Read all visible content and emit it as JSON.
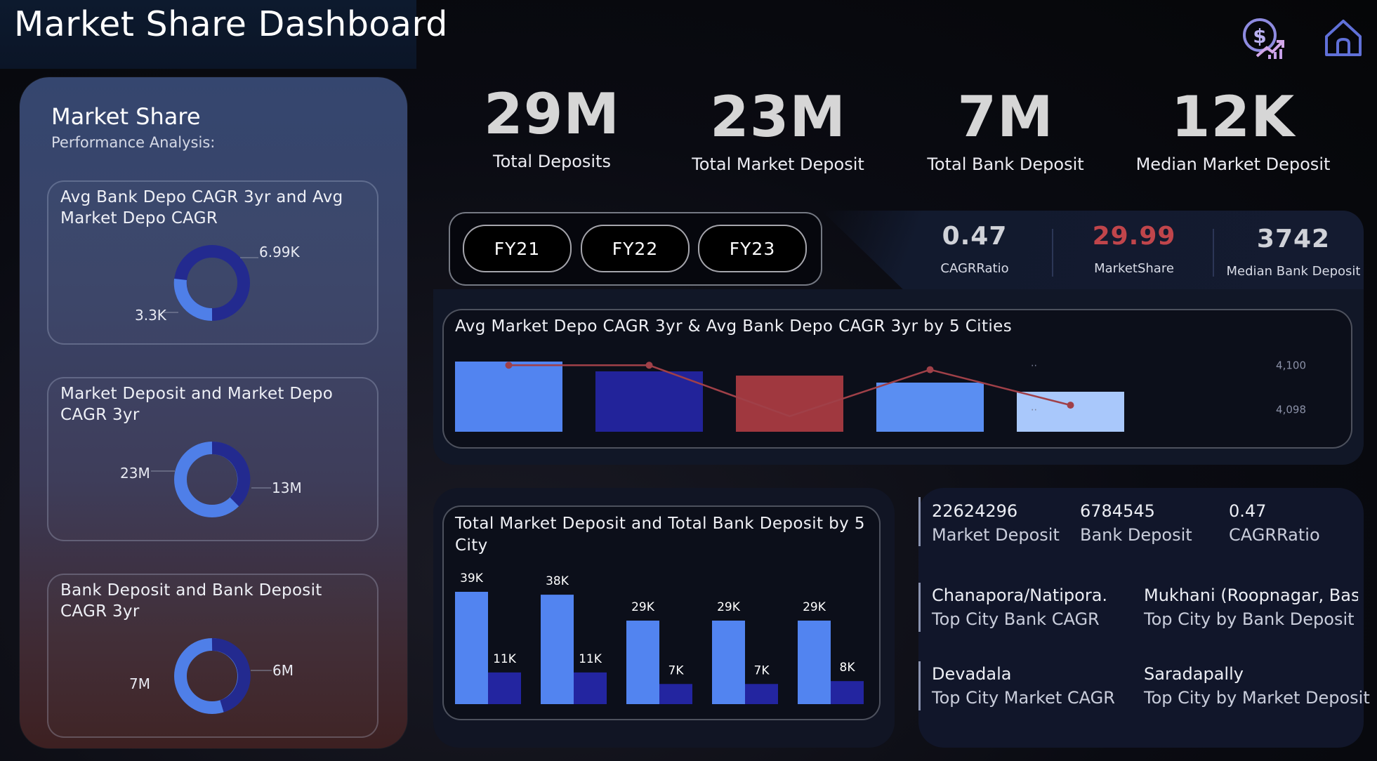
{
  "header": {
    "title": "Market Share Dashboard"
  },
  "left_panel": {
    "title": "Market Share",
    "subtitle": "Performance Analysis:",
    "cards": [
      {
        "title": "Avg Bank Depo CAGR 3yr and Avg Market Depo CAGR",
        "label_a": "6.99K",
        "label_b": "3.3K",
        "value_a": 6990,
        "value_b": 3300
      },
      {
        "title": "Market Deposit and Market Depo CAGR 3yr",
        "label_a": "13M",
        "label_b": "23M",
        "value_a": 13,
        "value_b": 23
      },
      {
        "title": "Bank Deposit and Bank Deposit CAGR 3yr",
        "label_a": "6M",
        "label_b": "7M",
        "value_a": 6,
        "value_b": 7
      }
    ]
  },
  "kpis": [
    {
      "value": "29M",
      "label": "Total Deposits"
    },
    {
      "value": "23M",
      "label": "Total Market Deposit"
    },
    {
      "value": "7M",
      "label": "Total Bank Deposit"
    },
    {
      "value": "12K",
      "label": "Median Market Deposit"
    }
  ],
  "fy_buttons": [
    "FY21",
    "FY22",
    "FY23"
  ],
  "stats": [
    {
      "value": "0.47",
      "label": "CAGRRatio",
      "color": "#d0d2d8"
    },
    {
      "value": "29.99",
      "label": "MarketShare",
      "color": "#c0454b"
    },
    {
      "value": "3742",
      "label": "Median Bank Deposit",
      "color": "#d0d2d8"
    }
  ],
  "colors": {
    "donut_dark": "#232a8f",
    "donut_light": "#4f7fe8",
    "bar_primary": "#5284f0",
    "bar_secondary": "#2325a0",
    "line": "#a04048",
    "stat_highlight": "#c0454b"
  },
  "info": {
    "row1": [
      {
        "value": "22624296",
        "label": "Market Deposit"
      },
      {
        "value": "6784545",
        "label": "Bank Deposit"
      },
      {
        "value": "0.47",
        "label": "CAGRRatio"
      }
    ],
    "row2": [
      {
        "value": "Chanapora/Natipora.",
        "label": "Top City Bank CAGR"
      },
      {
        "value": "Mukhani (Roopnagar, Bas...",
        "label": "Top City by Bank Deposit"
      }
    ],
    "row3": [
      {
        "value": "Devadala",
        "label": "Top City Market CAGR"
      },
      {
        "value": "Saradapally",
        "label": "Top City by Market Deposit"
      }
    ]
  },
  "chart_data": [
    {
      "type": "bar",
      "title": "Avg Market Depo CAGR 3yr & Avg Bank Depo CAGR 3yr by 5 Cities",
      "categories": [
        "",
        "",
        "",
        "",
        ""
      ],
      "series": [
        {
          "values": [
            1.0,
            0.86,
            0.8,
            0.7,
            0.57
          ],
          "colors": [
            "#5284f0",
            "#22239a",
            "#a0383f",
            "#5a8ef2",
            "#a9c8fb"
          ]
        },
        {
          "values": [
            4100,
            4100,
            4097.7,
            4099.8,
            4098.2
          ]
        }
      ],
      "y2_ticks": [
        "4,100",
        "4,098"
      ],
      "y2lim": [
        4097.0,
        4100.8
      ]
    },
    {
      "type": "bar",
      "title": "Total Market Deposit and Total Bank Deposit by 5 City",
      "categories": [
        "",
        "",
        "",
        "",
        ""
      ],
      "series": [
        {
          "values": [
            39,
            38,
            29,
            29,
            29
          ],
          "labels": [
            "39K",
            "38K",
            "29K",
            "29K",
            "29K"
          ]
        },
        {
          "values": [
            11,
            11,
            7,
            7,
            8
          ],
          "labels": [
            "11K",
            "11K",
            "7K",
            "7K",
            "8K"
          ]
        }
      ],
      "ylim": [
        0,
        42
      ]
    }
  ]
}
